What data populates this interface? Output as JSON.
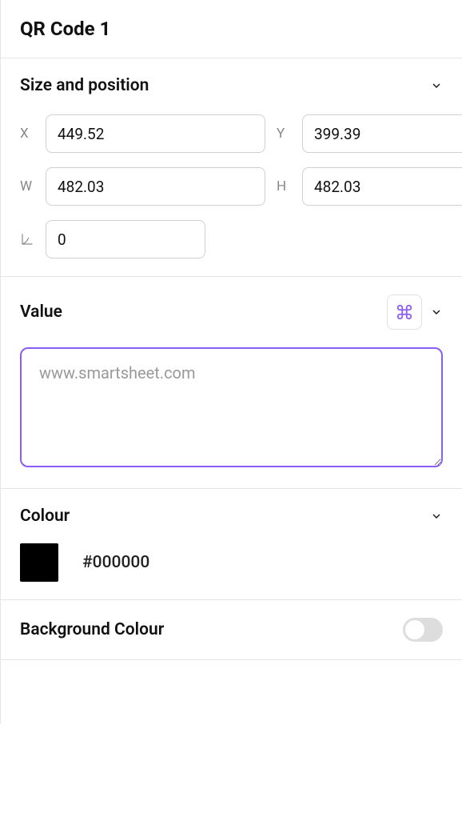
{
  "title": "QR Code 1",
  "sections": {
    "size_position": {
      "label": "Size and position",
      "x_label": "X",
      "x_value": "449.52",
      "y_label": "Y",
      "y_value": "399.39",
      "w_label": "W",
      "w_value": "482.03",
      "h_label": "H",
      "h_value": "482.03",
      "rotation_value": "0"
    },
    "value": {
      "label": "Value",
      "placeholder": "www.smartsheet.com",
      "text": ""
    },
    "colour": {
      "label": "Colour",
      "hex": "#000000",
      "swatch": "#000000"
    },
    "bg_colour": {
      "label": "Background Colour",
      "enabled": false
    }
  }
}
